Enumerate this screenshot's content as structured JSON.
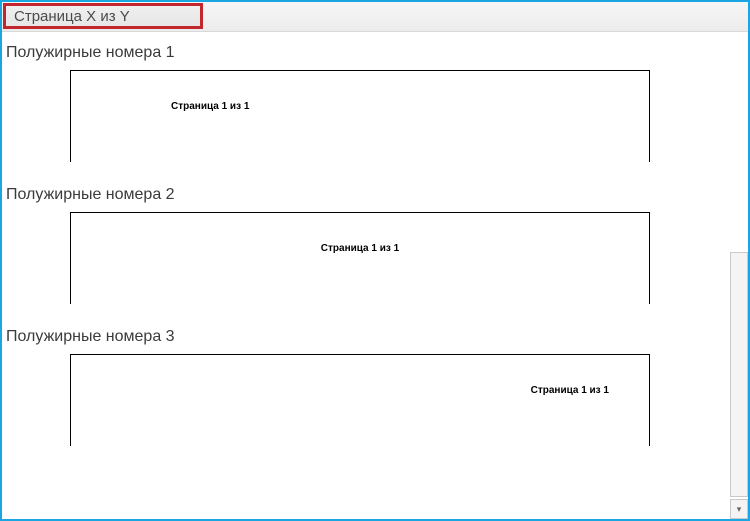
{
  "header": {
    "section_title": "Страница X из Y"
  },
  "options": [
    {
      "title": "Полужирные номера 1",
      "preview_text": "Страница 1 из 1",
      "align": "left"
    },
    {
      "title": "Полужирные номера 2",
      "preview_text": "Страница 1 из 1",
      "align": "center"
    },
    {
      "title": "Полужирные номера 3",
      "preview_text": "Страница 1 из 1",
      "align": "right"
    }
  ],
  "scrollbar": {
    "down_glyph": "▾"
  }
}
